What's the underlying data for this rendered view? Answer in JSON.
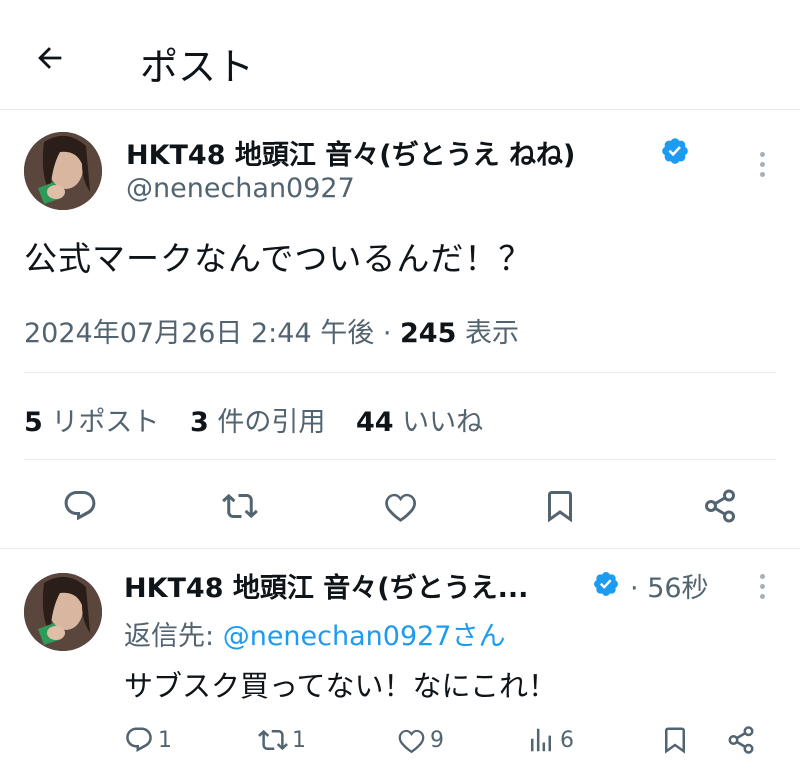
{
  "header": {
    "title": "ポスト",
    "back_icon": "arrow-left-icon"
  },
  "tweet": {
    "display_name": "HKT48 地頭江 音々(ぢとうえ ねね)",
    "handle": "@nenechan0927",
    "text": "公式マークなんでついるんだ！？",
    "timestamp": "2024年07月26日 2:44 午後",
    "separator": "·",
    "views_count": "245",
    "views_label": "表示",
    "stats": {
      "reposts_count": "5",
      "reposts_label": "リポスト",
      "quotes_count": "3",
      "quotes_label": "件の引用",
      "likes_count": "44",
      "likes_label": "いいね"
    },
    "actions": [
      "reply-icon",
      "repost-icon",
      "like-icon",
      "bookmark-icon",
      "share-icon"
    ]
  },
  "reply": {
    "display_name": "HKT48 地頭江 音々(ぢとうえ...",
    "time_separator": "·",
    "time": "56秒",
    "reply_to_label": "返信先:",
    "reply_to_handle": "@nenechan0927さん",
    "text": "サブスク買ってない！なにこれ！",
    "counts": {
      "replies": "1",
      "reposts": "1",
      "likes": "9",
      "views": "6"
    }
  },
  "colors": {
    "accent": "#1d9bf0",
    "text_primary": "#0f1419",
    "text_secondary": "#536471",
    "divider": "#e7e9ea"
  }
}
